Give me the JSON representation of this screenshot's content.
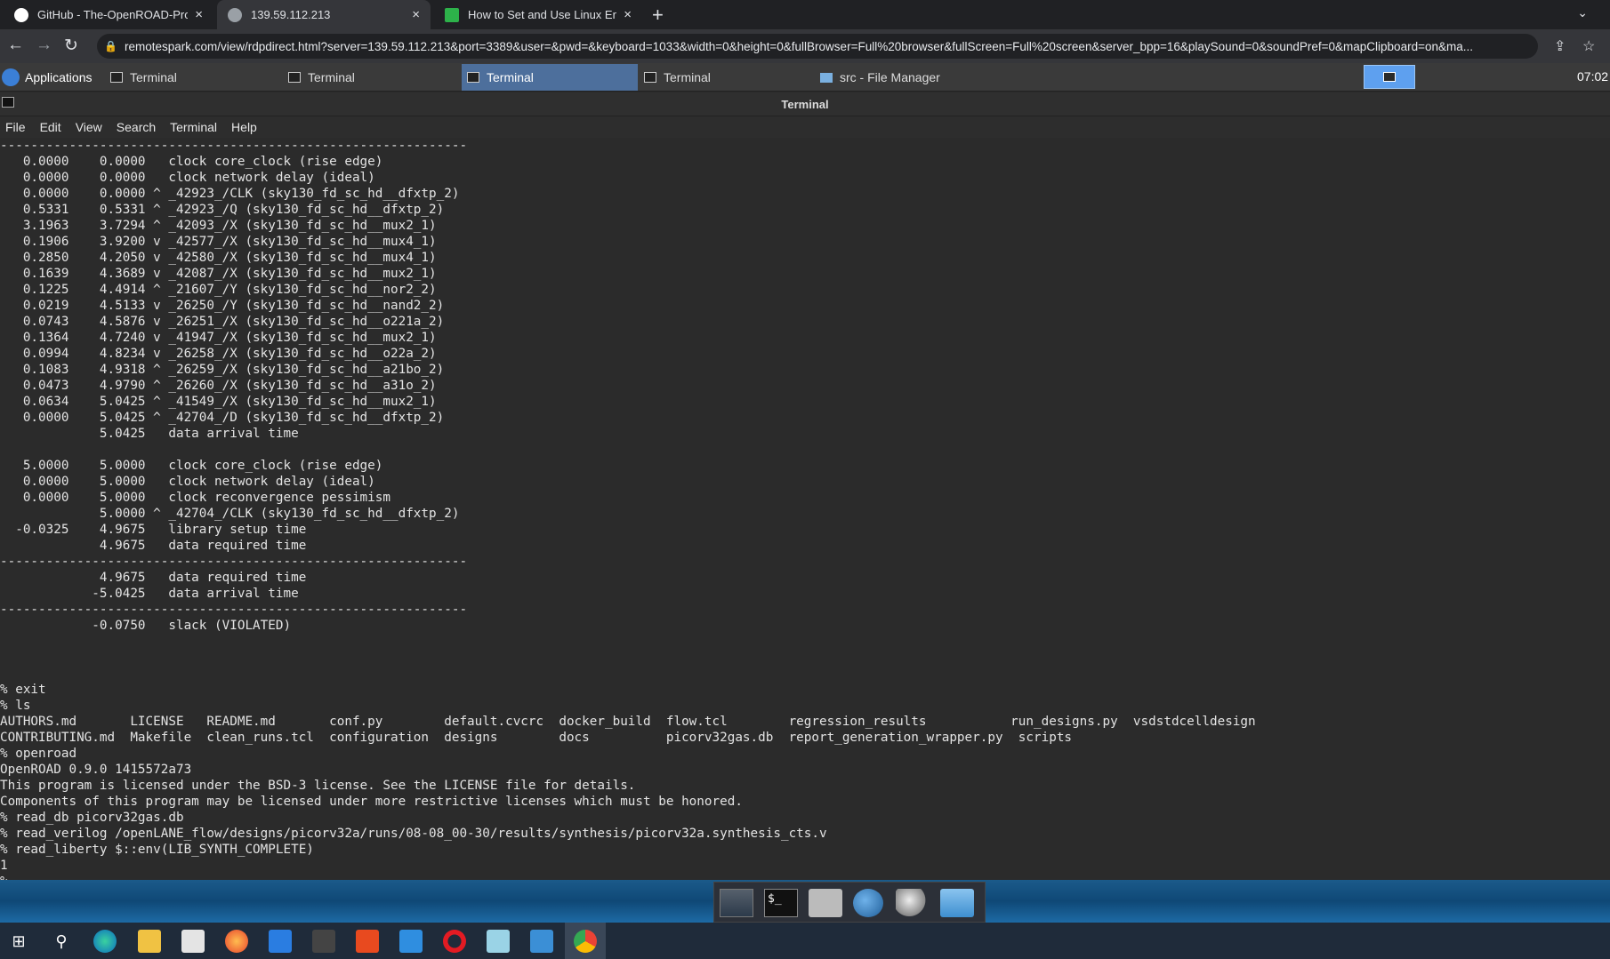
{
  "browser": {
    "tabs": [
      {
        "title": "GitHub - The-OpenROAD-Project",
        "close": "×"
      },
      {
        "title": "139.59.112.213",
        "close": "×"
      },
      {
        "title": "How to Set and Use Linux Enviro",
        "close": "×"
      }
    ],
    "new_tab": "+",
    "tab_list": "⌄",
    "nav": {
      "back": "←",
      "forward": "→",
      "reload": "↻"
    },
    "url": "remotespark.com/view/rdpdirect.html?server=139.59.112.213&port=3389&user=&pwd=&keyboard=1033&width=0&height=0&fullBrowser=Full%20browser&fullScreen=Full%20screen&server_bpp=16&playSound=0&soundPref=0&mapClipboard=on&ma...",
    "share_icon": "⇪",
    "star_icon": "☆"
  },
  "panel": {
    "applications": "Applications",
    "tasks": [
      "Terminal",
      "Terminal",
      "Terminal",
      "Terminal",
      "src - File Manager"
    ],
    "clock": "07:02"
  },
  "window": {
    "title": "Terminal",
    "menu": [
      "File",
      "Edit",
      "View",
      "Search",
      "Terminal",
      "Help"
    ]
  },
  "terminal_lines": [
    "-------------------------------------------------------------",
    "   0.0000    0.0000   clock core_clock (rise edge)",
    "   0.0000    0.0000   clock network delay (ideal)",
    "   0.0000    0.0000 ^ _42923_/CLK (sky130_fd_sc_hd__dfxtp_2)",
    "   0.5331    0.5331 ^ _42923_/Q (sky130_fd_sc_hd__dfxtp_2)",
    "   3.1963    3.7294 ^ _42093_/X (sky130_fd_sc_hd__mux2_1)",
    "   0.1906    3.9200 v _42577_/X (sky130_fd_sc_hd__mux4_1)",
    "   0.2850    4.2050 v _42580_/X (sky130_fd_sc_hd__mux4_1)",
    "   0.1639    4.3689 v _42087_/X (sky130_fd_sc_hd__mux2_1)",
    "   0.1225    4.4914 ^ _21607_/Y (sky130_fd_sc_hd__nor2_2)",
    "   0.0219    4.5133 v _26250_/Y (sky130_fd_sc_hd__nand2_2)",
    "   0.0743    4.5876 v _26251_/X (sky130_fd_sc_hd__o221a_2)",
    "   0.1364    4.7240 v _41947_/X (sky130_fd_sc_hd__mux2_1)",
    "   0.0994    4.8234 v _26258_/X (sky130_fd_sc_hd__o22a_2)",
    "   0.1083    4.9318 ^ _26259_/X (sky130_fd_sc_hd__a21bo_2)",
    "   0.0473    4.9790 ^ _26260_/X (sky130_fd_sc_hd__a31o_2)",
    "   0.0634    5.0425 ^ _41549_/X (sky130_fd_sc_hd__mux2_1)",
    "   0.0000    5.0425 ^ _42704_/D (sky130_fd_sc_hd__dfxtp_2)",
    "             5.0425   data arrival time",
    "",
    "   5.0000    5.0000   clock core_clock (rise edge)",
    "   0.0000    5.0000   clock network delay (ideal)",
    "   0.0000    5.0000   clock reconvergence pessimism",
    "             5.0000 ^ _42704_/CLK (sky130_fd_sc_hd__dfxtp_2)",
    "  -0.0325    4.9675   library setup time",
    "             4.9675   data required time",
    "-------------------------------------------------------------",
    "             4.9675   data required time",
    "            -5.0425   data arrival time",
    "-------------------------------------------------------------",
    "            -0.0750   slack (VIOLATED)",
    "",
    "",
    "",
    "% exit",
    "% ls",
    "AUTHORS.md       LICENSE   README.md       conf.py        default.cvcrc  docker_build  flow.tcl        regression_results           run_designs.py  vsdstdcelldesign",
    "CONTRIBUTING.md  Makefile  clean_runs.tcl  configuration  designs        docs          picorv32gas.db  report_generation_wrapper.py  scripts",
    "% openroad",
    "OpenROAD 0.9.0 1415572a73",
    "This program is licensed under the BSD-3 license. See the LICENSE file for details.",
    "Components of this program may be licensed under more restrictive licenses which must be honored.",
    "% read_db picorv32gas.db",
    "% read_verilog /openLANE_flow/designs/picorv32a/runs/08-08_00-30/results/synthesis/picorv32a.synthesis_cts.v",
    "% read_liberty $::env(LIB_SYNTH_COMPLETE)",
    "1",
    "%"
  ],
  "dock_icons": [
    "desktop-icon",
    "terminal-icon",
    "home-folder-icon",
    "web-browser-icon",
    "search-icon",
    "folder-icon"
  ],
  "taskbar_icons": [
    "windows-start-icon",
    "search-icon",
    "edge-icon",
    "file-explorer-icon",
    "store-icon",
    "firefox-icon",
    "dropbox-icon",
    "app-icon",
    "office-icon",
    "mail-icon",
    "opera-icon",
    "notes-icon",
    "photos-icon",
    "chrome-icon"
  ]
}
